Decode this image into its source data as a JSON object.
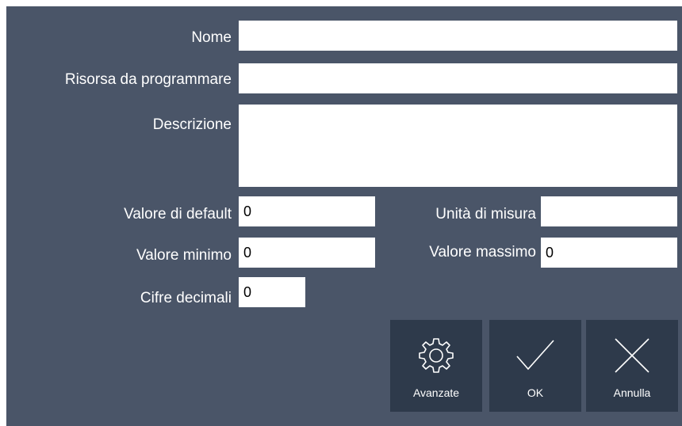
{
  "form": {
    "nome_label": "Nome",
    "nome_value": "",
    "risorsa_label": "Risorsa da programmare",
    "risorsa_value": "",
    "descrizione_label": "Descrizione",
    "descrizione_value": "",
    "default_label": "Valore di default",
    "default_value": "0",
    "unita_label": "Unità di misura",
    "unita_value": "",
    "minimo_label": "Valore minimo",
    "minimo_value": "0",
    "massimo_label": "Valore massimo",
    "massimo_value": "0",
    "decimali_label": "Cifre decimali",
    "decimali_value": "0"
  },
  "buttons": {
    "advanced_label": "Avanzate",
    "ok_label": "OK",
    "cancel_label": "Annulla"
  },
  "icons": {
    "advanced": "gear-icon",
    "ok": "checkmark-icon",
    "cancel": "close-icon"
  },
  "colors": {
    "panel_bg": "#4a5568",
    "button_bg": "#2e3a4b",
    "text": "#ffffff"
  }
}
